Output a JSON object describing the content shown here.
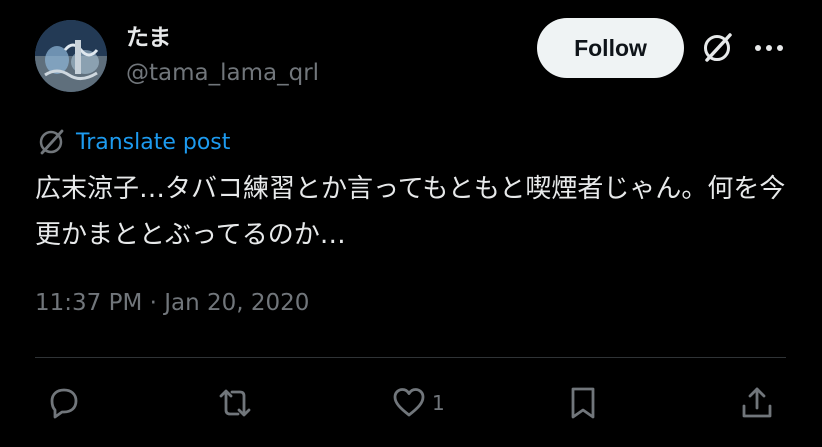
{
  "author": {
    "name": "たま",
    "handle": "@tama_lama_qrl",
    "avatar_icon": "profile-photo"
  },
  "header": {
    "follow_label": "Follow",
    "grok_icon": "grok-icon",
    "more_icon": "more-icon"
  },
  "post": {
    "translate_label": "Translate post",
    "text": "広末涼子…タバコ練習とか言ってもともと喫煙者じゃん。何を今更かまととぶってるのか…",
    "timestamp": "11:37 PM · Jan 20, 2020"
  },
  "actions": {
    "reply_icon": "reply-icon",
    "repost_icon": "repost-icon",
    "like_icon": "heart-icon",
    "like_count": "1",
    "bookmark_icon": "bookmark-icon",
    "share_icon": "share-icon"
  },
  "colors": {
    "background": "#000000",
    "text": "#e7e9ea",
    "muted": "#71767b",
    "link": "#1d9bf0",
    "button_bg": "#eff3f4"
  }
}
